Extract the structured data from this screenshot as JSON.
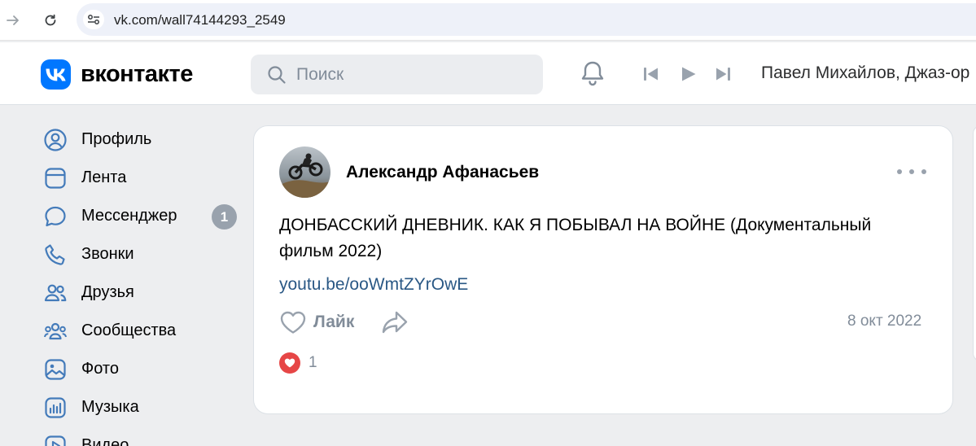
{
  "browser": {
    "url": "vk.com/wall74144293_2549",
    "icons": {
      "forward": "arrow-right-icon",
      "reload": "reload-icon",
      "site_info": "site-settings-icon"
    }
  },
  "header": {
    "logo_text": "вконтакте",
    "search_placeholder": "Поиск",
    "now_playing": "Павел Михайлов, Джаз-ор",
    "icons": {
      "notifications": "bell-icon",
      "prev": "previous-track-icon",
      "play": "play-icon",
      "next": "next-track-icon"
    }
  },
  "sidebar": {
    "items": [
      {
        "label": "Профиль",
        "icon": "profile-icon"
      },
      {
        "label": "Лента",
        "icon": "feed-icon"
      },
      {
        "label": "Мессенджер",
        "icon": "messenger-icon",
        "badge": "1"
      },
      {
        "label": "Звонки",
        "icon": "phone-icon"
      },
      {
        "label": "Друзья",
        "icon": "friends-icon"
      },
      {
        "label": "Сообщества",
        "icon": "communities-icon"
      },
      {
        "label": "Фото",
        "icon": "photo-icon"
      },
      {
        "label": "Музыка",
        "icon": "music-icon"
      },
      {
        "label": "Видео",
        "icon": "video-icon"
      }
    ]
  },
  "post": {
    "author": "Александр Афанасьев",
    "text": "ДОНБАССКИЙ ДНЕВНИК. КАК Я ПОБЫВАЛ НА ВОЙНЕ (Документальный фильм 2022)",
    "link": "youtu.be/ooWmtZYrOwE",
    "like_label": "Лайк",
    "date": "8 окт 2022",
    "reaction_count": "1",
    "colors": {
      "link": "#2a5885",
      "reaction": "#e64646",
      "accent": "#0077ff"
    }
  }
}
